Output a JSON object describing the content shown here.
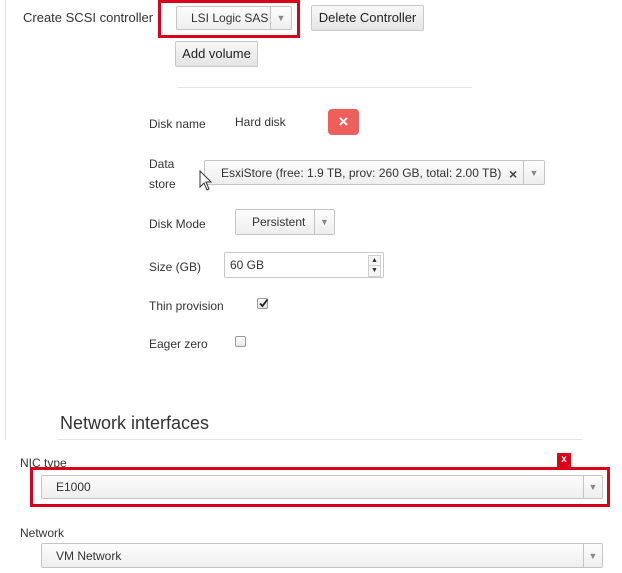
{
  "controller": {
    "label": "Create SCSI controller",
    "type_value": "LSI Logic SAS",
    "delete_button": "Delete Controller",
    "add_volume_button": "Add volume"
  },
  "disk": {
    "name_label": "Disk name",
    "name_value": "Hard disk",
    "remove_symbol": "×",
    "datastore_label_line1": "Data",
    "datastore_label_line2": "store",
    "datastore_value": "EsxiStore (free: 1.9 TB, prov: 260 GB, total: 2.00 TB)",
    "clear_symbol": "×",
    "mode_label": "Disk Mode",
    "mode_value": "Persistent",
    "size_label": "Size (GB)",
    "size_value": "60 GB",
    "thin_label": "Thin provision",
    "thin_checked": true,
    "eager_label": "Eager zero",
    "eager_checked": false
  },
  "network": {
    "section_title": "Network interfaces",
    "nic_label": "NIC type",
    "nic_remove": "x",
    "nic_value": "E1000",
    "network_label": "Network",
    "network_value": "VM Network"
  },
  "colors": {
    "highlight_red": "#d9001b",
    "remove_button": "#ee5f5b"
  }
}
